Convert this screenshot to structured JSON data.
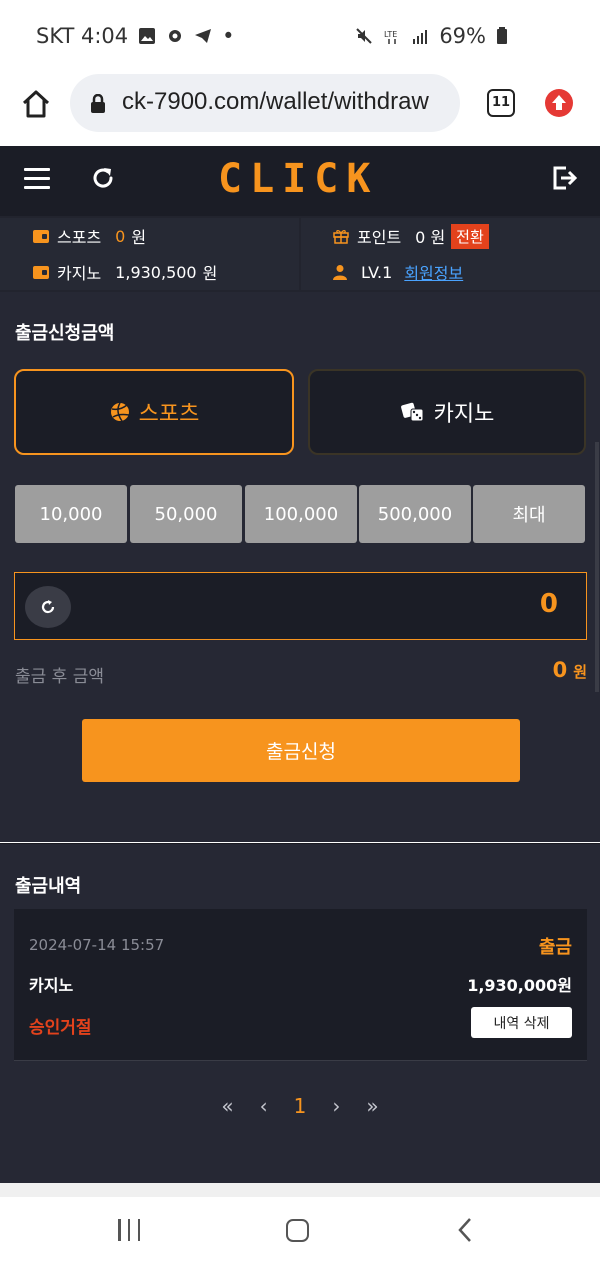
{
  "status_bar": {
    "carrier_time": "SKT 4:04",
    "battery": "69%"
  },
  "browser": {
    "url": "ck-7900.com/wallet/withdraw",
    "tab_count": "11"
  },
  "header": {
    "logo": "CLICK"
  },
  "info": {
    "sports_label": "스포츠",
    "sports_amount": "0",
    "sports_unit": "원",
    "point_label": "포인트",
    "point_amount": "0 원",
    "convert_label": "전환",
    "casino_label": "카지노",
    "casino_amount": "1,930,500",
    "casino_unit": "원",
    "level": "LV.1",
    "member_link": "회원정보"
  },
  "withdraw": {
    "title": "출금신청금액",
    "tabs": [
      {
        "label": "스포츠"
      },
      {
        "label": "카지노"
      }
    ],
    "amount_buttons": [
      "10,000",
      "50,000",
      "100,000",
      "500,000",
      "최대"
    ],
    "input_value": "0",
    "after_label": "출금 후 금액",
    "after_value": "0",
    "after_unit": "원",
    "submit_label": "출금신청"
  },
  "history": {
    "title": "출금내역",
    "items": [
      {
        "date": "2024-07-14 15:57",
        "type": "출금",
        "game": "카지노",
        "amount": "1,930,000원",
        "status": "승인거절",
        "delete_label": "내역 삭제"
      }
    ],
    "pagination": {
      "first": "«",
      "prev": "‹",
      "current": "1",
      "next": "›",
      "last": "»"
    }
  },
  "colors": {
    "accent": "#f7941e",
    "danger": "#e3421c",
    "bg_dark": "#1b1d26",
    "panel": "#262834"
  }
}
